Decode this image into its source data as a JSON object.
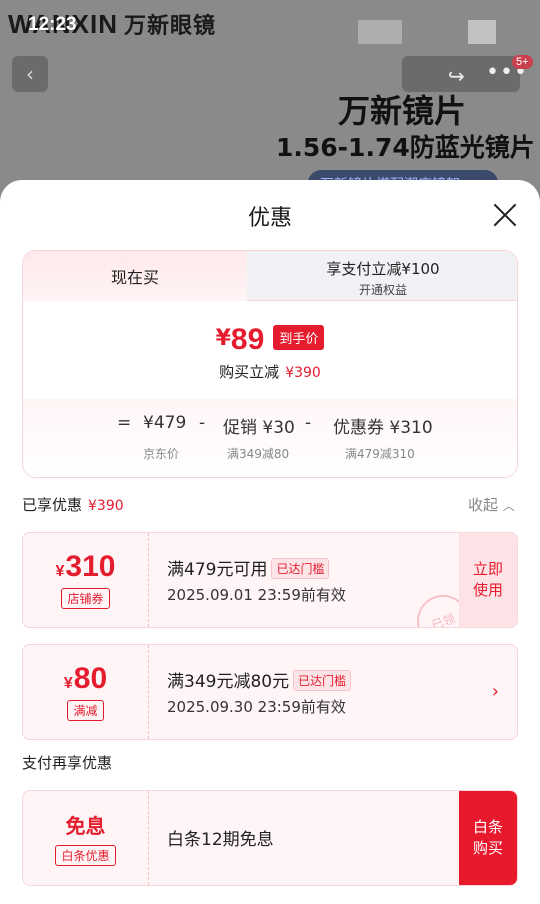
{
  "status_bar": {
    "time": "12:23"
  },
  "background": {
    "brand_logo": "WANXIN",
    "brand_cn": "万新眼镜",
    "notification_count": "5+",
    "lens_title": "万新镜片",
    "lens_subtitle": "1.56-1.74防蓝光镜片",
    "strip_text": "万新镜片搭配潮店镜架"
  },
  "sheet": {
    "title": "优惠",
    "tabs": {
      "now_label": "现在买",
      "pay_label": "享支付立减¥100",
      "pay_sublabel": "开通权益"
    },
    "price": {
      "currency": "¥",
      "final": "89",
      "final_tag": "到手价",
      "reduce_label": "购买立减",
      "reduce_value": "¥390"
    },
    "breakdown": {
      "equals": "=",
      "jd_price": "¥479",
      "minus1": "-",
      "promo_label": "促销 ¥30",
      "minus2": "-",
      "coupon_label": "优惠券 ¥310",
      "jd_price_caption": "京东价",
      "promo_caption": "满349减80",
      "coupon_caption": "满479减310"
    },
    "enjoyed": {
      "label": "已享优惠",
      "value": "¥390",
      "collapse_label": "收起"
    },
    "coupons": [
      {
        "currency": "¥",
        "amount": "310",
        "type": "店铺券",
        "condition": "满479元可用",
        "reached": "已达门槛",
        "expiry": "2025.09.01 23:59前有效",
        "action": "立即使用",
        "stamp": "已领"
      },
      {
        "currency": "¥",
        "amount": "80",
        "type": "满减",
        "condition": "满349元减80元",
        "reached": "已达门槛",
        "expiry": "2025.09.30 23:59前有效"
      }
    ],
    "pay_more_label": "支付再享优惠",
    "baitiao": {
      "title": "免息",
      "tag": "白条优惠",
      "desc": "白条12期免息",
      "action": "白条购买"
    }
  },
  "colors": {
    "accent": "#e41c2e",
    "card_bg": "#fff5f6",
    "button_bg": "#e8192c"
  }
}
